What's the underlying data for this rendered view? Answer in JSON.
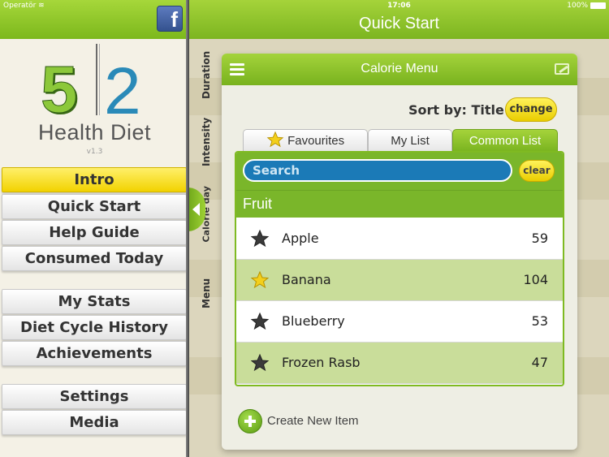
{
  "status": {
    "carrier": "Operatör",
    "time": "17:06",
    "battery": "100%"
  },
  "sidebar": {
    "logo": {
      "digit_left": "5",
      "digit_right": "2",
      "title": "Health Diet",
      "version": "v1.3"
    },
    "items": [
      {
        "label": "Intro",
        "active": true
      },
      {
        "label": "Quick Start"
      },
      {
        "label": "Help Guide"
      },
      {
        "label": "Consumed Today"
      },
      {
        "label": "My Stats"
      },
      {
        "label": "Diet Cycle History"
      },
      {
        "label": "Achievements"
      },
      {
        "label": "Settings"
      },
      {
        "label": "Media"
      }
    ],
    "facebook_icon": "facebook-icon"
  },
  "main": {
    "title": "Quick Start",
    "vertical_tabs": [
      "Duration",
      "Intensity",
      "Calorie day",
      "Menu"
    ]
  },
  "panel": {
    "title": "Calorie Menu",
    "sort_label": "Sort by: Title",
    "change_label": "change",
    "tabs": [
      {
        "label": "Favourites"
      },
      {
        "label": "My List"
      },
      {
        "label": "Common List",
        "active": true
      }
    ],
    "search_placeholder": "Search",
    "clear_label": "clear",
    "section": "Fruit",
    "rows": [
      {
        "name": "Apple",
        "calories": "59",
        "favourite": false
      },
      {
        "name": "Banana",
        "calories": "104",
        "favourite": true
      },
      {
        "name": "Blueberry",
        "calories": "53",
        "favourite": false
      },
      {
        "name": "Frozen Rasb",
        "calories": "47",
        "favourite": false
      }
    ],
    "create_label": "Create New Item"
  },
  "colors": {
    "accent_green": "#7cb81c",
    "highlight_yellow": "#f2d200",
    "search_blue": "#1b7ab7"
  }
}
